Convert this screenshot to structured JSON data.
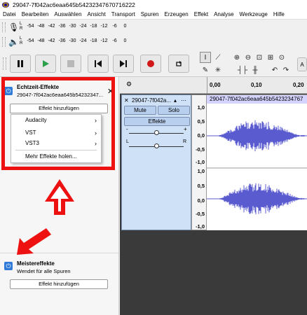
{
  "window": {
    "title": "29047-7f042ac6eaa645b54232347670716222"
  },
  "menu": [
    "Datei",
    "Bearbeiten",
    "Auswählen",
    "Ansicht",
    "Transport",
    "Spuren",
    "Erzeugen",
    "Effekt",
    "Analyse",
    "Werkzeuge",
    "Hilfe"
  ],
  "meters": {
    "record_scale": [
      "-54",
      "-48",
      "-42",
      "-36",
      "-30",
      "-24",
      "-18",
      "-12",
      "-6",
      "0"
    ],
    "play_scale": [
      "-54",
      "-48",
      "-42",
      "-36",
      "-30",
      "-24",
      "-18",
      "-12",
      "-6",
      "0"
    ],
    "l": "L",
    "r": "R"
  },
  "ruler": {
    "ticks": [
      "0,00",
      "0,10",
      "0,20"
    ]
  },
  "realtime": {
    "title": "Echtzeit-Effekte",
    "subtitle": "29047-7f042ac6eaa645b54232347...",
    "close": "✕",
    "add_button": "Effekt hinzufügen",
    "menu": [
      {
        "label": "Audacity",
        "arrow": "›"
      },
      {
        "label": "VST",
        "arrow": "›"
      },
      {
        "label": "VST3",
        "arrow": "›"
      },
      {
        "label": "Mehr Effekte holen...",
        "arrow": ""
      }
    ]
  },
  "master": {
    "title": "Meistereffekte",
    "subtitle": "Wendet für alle Spuren",
    "add_button": "Effekt hinzufügen"
  },
  "track": {
    "name": "29047-7f042a...",
    "mute": "Mute",
    "solo": "Solo",
    "effects": "Effekte",
    "gain_minus": "-",
    "gain_plus": "+",
    "pan_l": "L",
    "pan_r": "R",
    "clip_name": "29047-7f042ac6eaa645b5423234767",
    "scale": [
      "1,0",
      "0,5",
      "0,0",
      "-0,5",
      "-1,0",
      "1,0",
      "0,5",
      "0,0",
      "-0,5",
      "-1,0"
    ]
  },
  "colors": {
    "accent": "#2f7bd6",
    "annotation": "#ee1111",
    "waveform": "#5b5bd0",
    "track_bg": "#cfe1f7"
  },
  "annotations": {
    "box": "red-rectangle",
    "arrow_up": "red-arrow-up",
    "arrow_diag": "red-arrow-diagonal"
  }
}
